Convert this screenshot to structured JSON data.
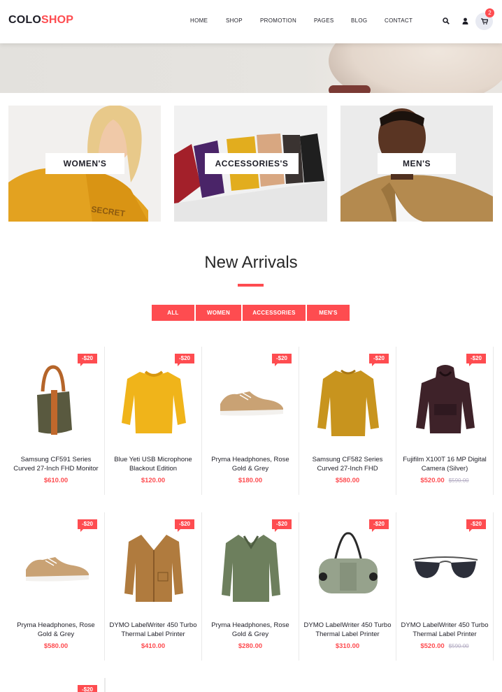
{
  "header": {
    "logo_part1": "COLO",
    "logo_part2": "SHOP",
    "nav": [
      "HOME",
      "SHOP",
      "PROMOTION",
      "PAGES",
      "BLOG",
      "CONTACT"
    ],
    "cart_count": "2",
    "icons": [
      "search-icon",
      "user-icon",
      "cart-icon"
    ]
  },
  "banners": [
    "WOMEN'S",
    "ACCESSORIES'S",
    "MEN'S"
  ],
  "section": {
    "title": "New Arrivals"
  },
  "filters": [
    "ALL",
    "WOMEN",
    "ACCESSORIES",
    "MEN'S"
  ],
  "colors": {
    "accent": "#fe4c50",
    "text": "#1e1e27"
  },
  "products": [
    {
      "name": "Samsung CF591 Series Curved 27-Inch FHD Monitor",
      "price": "$610.00",
      "old_price": "",
      "badge": "-$20",
      "kind": "bag"
    },
    {
      "name": "Blue Yeti USB Microphone Blackout Edition",
      "price": "$120.00",
      "old_price": "",
      "badge": "-$20",
      "kind": "sweater-yellow"
    },
    {
      "name": "Pryma Headphones, Rose Gold & Grey",
      "price": "$180.00",
      "old_price": "",
      "badge": "-$20",
      "kind": "shoe"
    },
    {
      "name": "Samsung CF582 Series Curved 27-Inch FHD",
      "price": "$580.00",
      "old_price": "",
      "badge": "-$20",
      "kind": "sweater-mustard"
    },
    {
      "name": "Fujifilm X100T 16 MP Digital Camera (Silver)",
      "price": "$520.00",
      "old_price": "$590.00",
      "badge": "-$20",
      "kind": "hoodie"
    },
    {
      "name": "Pryma Headphones, Rose Gold & Grey",
      "price": "$580.00",
      "old_price": "",
      "badge": "-$20",
      "kind": "shoe"
    },
    {
      "name": "DYMO LabelWriter 450 Turbo Thermal Label Printer",
      "price": "$410.00",
      "old_price": "",
      "badge": "-$20",
      "kind": "jacket"
    },
    {
      "name": "Pryma Headphones, Rose Gold & Grey",
      "price": "$280.00",
      "old_price": "",
      "badge": "-$20",
      "kind": "sweater-green"
    },
    {
      "name": "DYMO LabelWriter 450 Turbo Thermal Label Printer",
      "price": "$310.00",
      "old_price": "",
      "badge": "-$20",
      "kind": "duffel"
    },
    {
      "name": "DYMO LabelWriter 450 Turbo Thermal Label Printer",
      "price": "$520.00",
      "old_price": "$590.00",
      "badge": "-$20",
      "kind": "sunglasses"
    }
  ],
  "partial_badge": "-$20"
}
